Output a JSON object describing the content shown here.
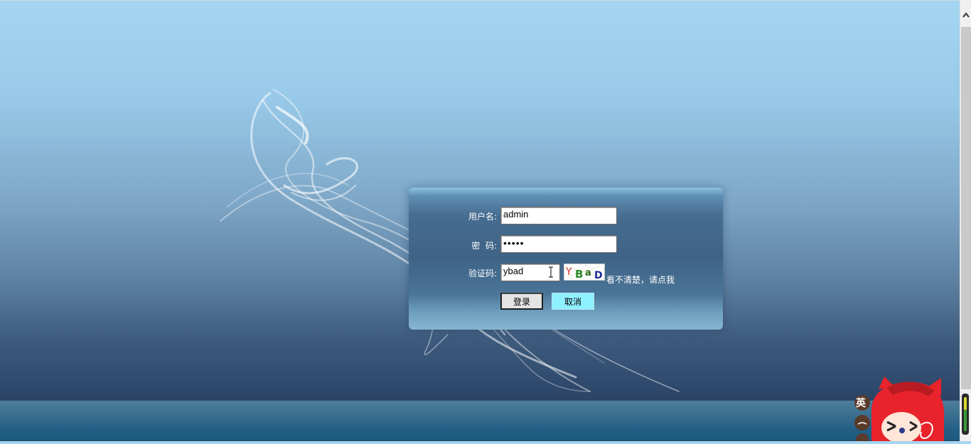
{
  "login": {
    "username_label": "用户名:",
    "username_value": "admin",
    "password_label": "密  码:",
    "password_value": "•••••",
    "captcha_label": "验证码:",
    "captcha_value": "ybad",
    "captcha_image_text": "YBaD",
    "refresh_link": "看不清楚，请点我",
    "login_button": "登录",
    "cancel_button": "取消"
  },
  "ime": {
    "mode_label": "英"
  },
  "colors": {
    "panel_top": "#8cc3e0",
    "panel_mid": "#3e6386",
    "cancel_button_bg": "#8ff0ff",
    "login_button_bg": "#e4e4e4",
    "bg_top": "#a4d6f2",
    "bg_bottom": "#2b4567"
  },
  "icons": {
    "scroll_up": "chevron-up-icon",
    "text_cursor": "i-beam-cursor-icon",
    "mascot": "red-fox-mascot-icon"
  }
}
